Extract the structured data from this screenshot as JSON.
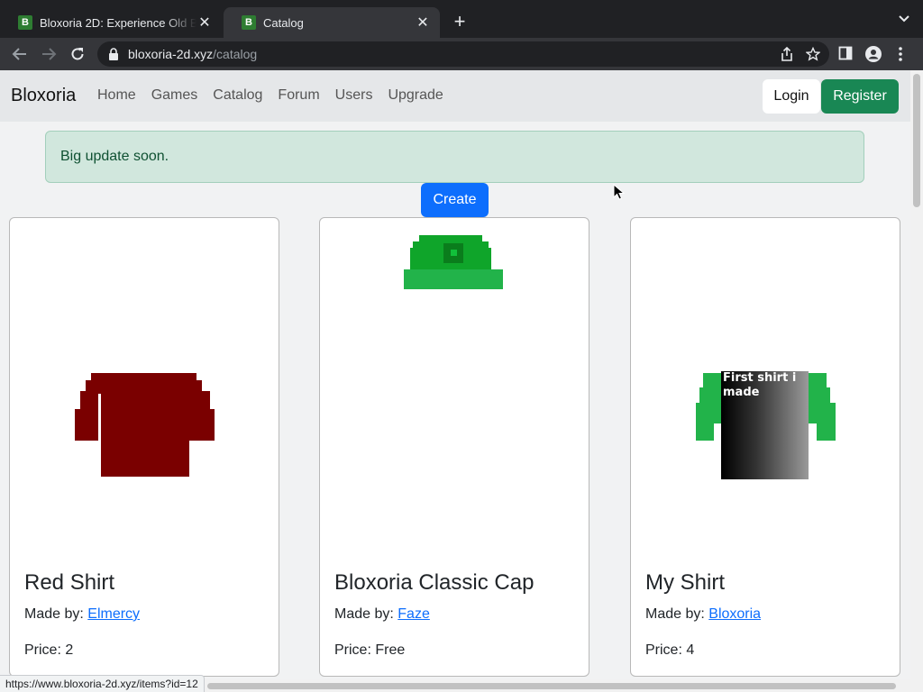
{
  "browser": {
    "tabs": [
      {
        "favicon": "B",
        "title": "Bloxoria 2D: Experience Old Bl",
        "active": false
      },
      {
        "favicon": "B",
        "title": "Catalog",
        "active": true
      }
    ],
    "new_tab_label": "+",
    "url_host": "bloxoria-2d.xyz",
    "url_path": "/catalog",
    "status_url": "https://www.bloxoria-2d.xyz/items?id=12"
  },
  "nav": {
    "brand": "Bloxoria",
    "links": [
      "Home",
      "Games",
      "Catalog",
      "Forum",
      "Users",
      "Upgrade"
    ],
    "login": "Login",
    "register": "Register"
  },
  "alert": {
    "text": "Big update soon."
  },
  "create_button": "Create",
  "items": [
    {
      "name": "Red Shirt",
      "made_by_label": "Made by:",
      "creator": "Elmercy",
      "price_label": "Price:",
      "price": "2"
    },
    {
      "name": "Bloxoria Classic Cap",
      "made_by_label": "Made by:",
      "creator": "Faze",
      "price_label": "Price:",
      "price": "Free"
    },
    {
      "name": "My Shirt",
      "made_by_label": "Made by:",
      "creator": "Bloxoria",
      "price_label": "Price:",
      "price": "4",
      "image_text": "First shirt i made"
    }
  ],
  "colors": {
    "register": "#198754",
    "create": "#0d6efd",
    "alert_bg": "#d1e7dd",
    "red_shirt": "#7a0000",
    "cap_green": "#0fa52a",
    "sleeve_green": "#22b34a"
  }
}
